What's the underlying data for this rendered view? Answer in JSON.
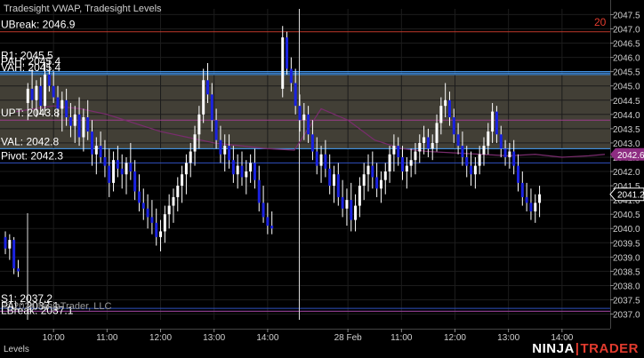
{
  "chart_data": {
    "type": "candlestick",
    "indicators_title": "Tradesight VWAP, Tradesight Levels",
    "y_range": [
      2036.8,
      2047.7
    ],
    "y_ticks": [
      "2047.5",
      "2047.0",
      "2046.5",
      "2046.0",
      "2045.5",
      "2045.0",
      "2044.5",
      "2044.0",
      "2043.5",
      "2043.0",
      "2042.5",
      "2042.0",
      "2041.5",
      "2041.0",
      "2040.5",
      "2040.0",
      "2039.5",
      "2039.0",
      "2038.5",
      "2038.0",
      "2037.5",
      "2037.0"
    ],
    "x_ticks": [
      "10:00",
      "11:00",
      "12:00",
      "13:00",
      "14:00",
      "28 Feb",
      "11:00",
      "12:00",
      "13:00",
      "14:00"
    ],
    "x_tick_positions": [
      1.0,
      2.0,
      3.0,
      4.0,
      5.0,
      6.5,
      7.5,
      8.5,
      9.5,
      10.5
    ],
    "x_range": [
      0.0,
      11.4
    ],
    "session_start_marker": 5.6,
    "levels": [
      {
        "label": "UBreak: 2046.9",
        "price": 2046.9,
        "color": "#c0392b"
      },
      {
        "label": "R1: 2045.5",
        "price": 2045.5,
        "color": "#4aa3ff"
      },
      {
        "label": "PAH: 2045.4",
        "price": 2045.45,
        "color": "#4aa3ff"
      },
      {
        "label": "VAH: 2045.4",
        "price": 2045.4,
        "color": "#4aa3ff"
      },
      {
        "label": "UPT: 2043.8",
        "price": 2043.8,
        "color": "#9b3d8a"
      },
      {
        "label": "VAL: 2042.8",
        "price": 2042.8,
        "color": "#4aa3ff"
      },
      {
        "label": "Pivot: 2042.3",
        "price": 2042.3,
        "color": "#2f4fbf"
      },
      {
        "label": "S1: 2037.2",
        "price": 2037.2,
        "color": "#2f4fbf"
      },
      {
        "label": "PAL: 2037.1",
        "price": 2037.1,
        "color": "#2f4fbf"
      },
      {
        "label": "LBreak: 2037.1",
        "price": 2037.1,
        "color": "#9b3d8a"
      }
    ],
    "value_area": {
      "top": 2045.4,
      "bottom": 2042.8,
      "color": "#4d4a3f"
    },
    "price_marker_top_text": "20",
    "price_marker_top_value": 2047.3,
    "vwap_label": "2042.6",
    "vwap_value": 2042.6,
    "last_price_label": "2041.2",
    "last_price_value": 2041.2,
    "vwap": {
      "x": [
        0.3,
        1.0,
        1.5,
        2.0,
        2.5,
        3.0,
        3.5,
        4.0,
        4.5,
        5.0,
        5.5,
        6.0,
        6.5,
        7.0,
        7.5,
        8.0,
        8.5,
        9.0,
        9.5,
        10.0,
        10.5,
        11.0,
        11.3
      ],
      "y": [
        2044.1,
        2044.3,
        2044.2,
        2044.0,
        2043.7,
        2043.4,
        2043.2,
        2043.0,
        2042.9,
        2042.8,
        2042.75,
        2044.2,
        2043.8,
        2043.1,
        2042.8,
        2042.7,
        2042.65,
        2042.6,
        2042.55,
        2042.6,
        2042.5,
        2042.55,
        2042.6
      ]
    },
    "candles": [
      {
        "x": 0.1,
        "o": 2039.7,
        "h": 2039.9,
        "l": 2039.1,
        "c": 2039.3
      },
      {
        "x": 0.18,
        "o": 2039.3,
        "h": 2039.8,
        "l": 2038.9,
        "c": 2039.6
      },
      {
        "x": 0.26,
        "o": 2039.6,
        "h": 2039.7,
        "l": 2038.4,
        "c": 2038.6
      },
      {
        "x": 0.34,
        "o": 2038.6,
        "h": 2038.9,
        "l": 2038.3,
        "c": 2038.5
      },
      {
        "x": 0.52,
        "o": 2044.4,
        "h": 2045.1,
        "l": 2043.8,
        "c": 2044.9
      },
      {
        "x": 0.6,
        "o": 2044.9,
        "h": 2045.6,
        "l": 2044.2,
        "c": 2044.5
      },
      {
        "x": 0.68,
        "o": 2044.5,
        "h": 2045.2,
        "l": 2043.9,
        "c": 2045.0
      },
      {
        "x": 0.76,
        "o": 2045.0,
        "h": 2045.3,
        "l": 2044.0,
        "c": 2044.3
      },
      {
        "x": 0.84,
        "o": 2044.3,
        "h": 2045.8,
        "l": 2044.0,
        "c": 2045.4
      },
      {
        "x": 0.92,
        "o": 2045.4,
        "h": 2045.9,
        "l": 2044.8,
        "c": 2045.0
      },
      {
        "x": 1.0,
        "o": 2045.0,
        "h": 2045.5,
        "l": 2044.4,
        "c": 2044.6
      },
      {
        "x": 1.08,
        "o": 2044.6,
        "h": 2045.0,
        "l": 2043.9,
        "c": 2044.2
      },
      {
        "x": 1.16,
        "o": 2044.2,
        "h": 2044.8,
        "l": 2043.4,
        "c": 2044.5
      },
      {
        "x": 1.24,
        "o": 2044.5,
        "h": 2044.9,
        "l": 2043.6,
        "c": 2043.9
      },
      {
        "x": 1.32,
        "o": 2043.9,
        "h": 2044.4,
        "l": 2043.2,
        "c": 2043.6
      },
      {
        "x": 1.4,
        "o": 2043.6,
        "h": 2044.3,
        "l": 2043.0,
        "c": 2044.0
      },
      {
        "x": 1.48,
        "o": 2044.0,
        "h": 2044.6,
        "l": 2042.9,
        "c": 2043.2
      },
      {
        "x": 1.56,
        "o": 2043.2,
        "h": 2044.2,
        "l": 2042.7,
        "c": 2043.9
      },
      {
        "x": 1.64,
        "o": 2043.9,
        "h": 2044.5,
        "l": 2043.1,
        "c": 2043.4
      },
      {
        "x": 1.72,
        "o": 2043.4,
        "h": 2043.8,
        "l": 2042.2,
        "c": 2042.6
      },
      {
        "x": 1.8,
        "o": 2042.6,
        "h": 2043.2,
        "l": 2041.9,
        "c": 2042.9
      },
      {
        "x": 1.88,
        "o": 2042.9,
        "h": 2043.4,
        "l": 2042.3,
        "c": 2042.5
      },
      {
        "x": 1.96,
        "o": 2042.5,
        "h": 2043.1,
        "l": 2041.8,
        "c": 2042.2
      },
      {
        "x": 2.04,
        "o": 2042.2,
        "h": 2042.8,
        "l": 2041.1,
        "c": 2041.6
      },
      {
        "x": 2.12,
        "o": 2041.6,
        "h": 2042.7,
        "l": 2041.3,
        "c": 2042.4
      },
      {
        "x": 2.2,
        "o": 2042.4,
        "h": 2042.9,
        "l": 2041.8,
        "c": 2042.1
      },
      {
        "x": 2.28,
        "o": 2042.1,
        "h": 2042.6,
        "l": 2041.4,
        "c": 2041.9
      },
      {
        "x": 2.36,
        "o": 2041.9,
        "h": 2042.5,
        "l": 2041.2,
        "c": 2042.3
      },
      {
        "x": 2.44,
        "o": 2042.3,
        "h": 2043.0,
        "l": 2041.7,
        "c": 2042.0
      },
      {
        "x": 2.52,
        "o": 2042.0,
        "h": 2042.4,
        "l": 2041.0,
        "c": 2041.3
      },
      {
        "x": 2.6,
        "o": 2041.3,
        "h": 2041.9,
        "l": 2040.6,
        "c": 2040.9
      },
      {
        "x": 2.68,
        "o": 2040.9,
        "h": 2041.4,
        "l": 2040.3,
        "c": 2040.7
      },
      {
        "x": 2.76,
        "o": 2040.7,
        "h": 2041.2,
        "l": 2040.0,
        "c": 2040.4
      },
      {
        "x": 2.84,
        "o": 2040.4,
        "h": 2041.0,
        "l": 2039.8,
        "c": 2040.2
      },
      {
        "x": 2.92,
        "o": 2040.2,
        "h": 2040.7,
        "l": 2039.4,
        "c": 2039.7
      },
      {
        "x": 3.0,
        "o": 2039.7,
        "h": 2040.3,
        "l": 2039.2,
        "c": 2039.9
      },
      {
        "x": 3.08,
        "o": 2039.9,
        "h": 2040.8,
        "l": 2039.5,
        "c": 2040.5
      },
      {
        "x": 3.16,
        "o": 2040.5,
        "h": 2041.2,
        "l": 2040.0,
        "c": 2040.8
      },
      {
        "x": 3.24,
        "o": 2040.8,
        "h": 2041.4,
        "l": 2040.2,
        "c": 2041.1
      },
      {
        "x": 3.32,
        "o": 2041.1,
        "h": 2041.8,
        "l": 2040.6,
        "c": 2041.5
      },
      {
        "x": 3.4,
        "o": 2041.5,
        "h": 2042.2,
        "l": 2040.9,
        "c": 2041.9
      },
      {
        "x": 3.48,
        "o": 2041.9,
        "h": 2042.6,
        "l": 2041.2,
        "c": 2042.3
      },
      {
        "x": 3.56,
        "o": 2042.3,
        "h": 2043.0,
        "l": 2041.8,
        "c": 2042.7
      },
      {
        "x": 3.64,
        "o": 2042.7,
        "h": 2043.6,
        "l": 2042.2,
        "c": 2043.3
      },
      {
        "x": 3.72,
        "o": 2043.3,
        "h": 2044.3,
        "l": 2042.8,
        "c": 2044.0
      },
      {
        "x": 3.8,
        "o": 2044.0,
        "h": 2045.6,
        "l": 2043.7,
        "c": 2045.2
      },
      {
        "x": 3.88,
        "o": 2045.2,
        "h": 2045.8,
        "l": 2044.4,
        "c": 2044.7
      },
      {
        "x": 3.96,
        "o": 2044.7,
        "h": 2045.1,
        "l": 2043.4,
        "c": 2043.8
      },
      {
        "x": 4.04,
        "o": 2043.8,
        "h": 2044.2,
        "l": 2042.8,
        "c": 2043.1
      },
      {
        "x": 4.12,
        "o": 2043.1,
        "h": 2043.6,
        "l": 2042.3,
        "c": 2042.6
      },
      {
        "x": 4.2,
        "o": 2042.6,
        "h": 2043.3,
        "l": 2042.0,
        "c": 2042.9
      },
      {
        "x": 4.28,
        "o": 2042.9,
        "h": 2043.3,
        "l": 2042.1,
        "c": 2042.4
      },
      {
        "x": 4.36,
        "o": 2042.4,
        "h": 2042.9,
        "l": 2041.6,
        "c": 2041.9
      },
      {
        "x": 4.44,
        "o": 2041.9,
        "h": 2042.6,
        "l": 2041.4,
        "c": 2042.2
      },
      {
        "x": 4.52,
        "o": 2042.2,
        "h": 2042.7,
        "l": 2041.5,
        "c": 2041.8
      },
      {
        "x": 4.6,
        "o": 2041.8,
        "h": 2042.4,
        "l": 2041.2,
        "c": 2042.0
      },
      {
        "x": 4.68,
        "o": 2042.0,
        "h": 2042.6,
        "l": 2041.6,
        "c": 2042.3
      },
      {
        "x": 4.76,
        "o": 2042.3,
        "h": 2042.8,
        "l": 2041.4,
        "c": 2041.7
      },
      {
        "x": 4.84,
        "o": 2041.7,
        "h": 2042.2,
        "l": 2040.6,
        "c": 2040.9
      },
      {
        "x": 4.92,
        "o": 2040.9,
        "h": 2041.5,
        "l": 2040.2,
        "c": 2040.4
      },
      {
        "x": 5.0,
        "o": 2040.4,
        "h": 2040.9,
        "l": 2039.8,
        "c": 2040.1
      },
      {
        "x": 5.08,
        "o": 2040.1,
        "h": 2040.6,
        "l": 2039.8,
        "c": 2040.0
      },
      {
        "x": 5.28,
        "o": 2044.9,
        "h": 2047.1,
        "l": 2044.6,
        "c": 2046.7
      },
      {
        "x": 5.36,
        "o": 2046.7,
        "h": 2046.9,
        "l": 2045.4,
        "c": 2045.6
      },
      {
        "x": 5.44,
        "o": 2045.6,
        "h": 2046.0,
        "l": 2044.8,
        "c": 2045.1
      },
      {
        "x": 5.52,
        "o": 2045.1,
        "h": 2045.6,
        "l": 2044.0,
        "c": 2044.3
      },
      {
        "x": 5.6,
        "o": 2044.3,
        "h": 2044.7,
        "l": 2043.4,
        "c": 2043.8
      },
      {
        "x": 5.68,
        "o": 2043.8,
        "h": 2044.4,
        "l": 2043.1,
        "c": 2044.0
      },
      {
        "x": 5.76,
        "o": 2044.0,
        "h": 2044.3,
        "l": 2043.0,
        "c": 2043.3
      },
      {
        "x": 5.84,
        "o": 2043.3,
        "h": 2043.8,
        "l": 2042.4,
        "c": 2042.7
      },
      {
        "x": 5.92,
        "o": 2042.7,
        "h": 2043.2,
        "l": 2041.9,
        "c": 2042.2
      },
      {
        "x": 6.0,
        "o": 2042.2,
        "h": 2042.9,
        "l": 2041.6,
        "c": 2042.6
      },
      {
        "x": 6.08,
        "o": 2042.6,
        "h": 2043.1,
        "l": 2041.8,
        "c": 2042.1
      },
      {
        "x": 6.16,
        "o": 2042.1,
        "h": 2042.6,
        "l": 2041.2,
        "c": 2041.5
      },
      {
        "x": 6.24,
        "o": 2041.5,
        "h": 2042.2,
        "l": 2040.9,
        "c": 2041.9
      },
      {
        "x": 6.32,
        "o": 2041.9,
        "h": 2042.3,
        "l": 2040.8,
        "c": 2041.1
      },
      {
        "x": 6.4,
        "o": 2041.1,
        "h": 2041.7,
        "l": 2040.4,
        "c": 2040.7
      },
      {
        "x": 6.48,
        "o": 2040.7,
        "h": 2041.4,
        "l": 2040.1,
        "c": 2041.0
      },
      {
        "x": 6.56,
        "o": 2041.0,
        "h": 2041.6,
        "l": 2039.9,
        "c": 2040.3
      },
      {
        "x": 6.64,
        "o": 2040.3,
        "h": 2041.2,
        "l": 2039.9,
        "c": 2040.8
      },
      {
        "x": 6.72,
        "o": 2040.8,
        "h": 2041.8,
        "l": 2040.4,
        "c": 2041.5
      },
      {
        "x": 6.8,
        "o": 2041.5,
        "h": 2042.3,
        "l": 2041.0,
        "c": 2041.9
      },
      {
        "x": 6.88,
        "o": 2041.9,
        "h": 2042.6,
        "l": 2041.3,
        "c": 2042.2
      },
      {
        "x": 6.96,
        "o": 2042.2,
        "h": 2042.7,
        "l": 2041.4,
        "c": 2041.8
      },
      {
        "x": 7.04,
        "o": 2041.8,
        "h": 2042.3,
        "l": 2041.1,
        "c": 2041.4
      },
      {
        "x": 7.12,
        "o": 2041.4,
        "h": 2042.0,
        "l": 2040.9,
        "c": 2041.7
      },
      {
        "x": 7.2,
        "o": 2041.7,
        "h": 2042.3,
        "l": 2041.2,
        "c": 2042.0
      },
      {
        "x": 7.28,
        "o": 2042.0,
        "h": 2042.9,
        "l": 2041.6,
        "c": 2042.6
      },
      {
        "x": 7.36,
        "o": 2042.6,
        "h": 2043.3,
        "l": 2042.0,
        "c": 2042.9
      },
      {
        "x": 7.44,
        "o": 2042.9,
        "h": 2043.2,
        "l": 2042.2,
        "c": 2042.5
      },
      {
        "x": 7.52,
        "o": 2042.5,
        "h": 2042.9,
        "l": 2041.7,
        "c": 2042.0
      },
      {
        "x": 7.6,
        "o": 2042.0,
        "h": 2042.5,
        "l": 2041.4,
        "c": 2042.2
      },
      {
        "x": 7.68,
        "o": 2042.2,
        "h": 2042.8,
        "l": 2041.8,
        "c": 2042.4
      },
      {
        "x": 7.76,
        "o": 2042.4,
        "h": 2043.0,
        "l": 2041.9,
        "c": 2042.7
      },
      {
        "x": 7.84,
        "o": 2042.7,
        "h": 2043.3,
        "l": 2042.3,
        "c": 2043.0
      },
      {
        "x": 7.92,
        "o": 2043.0,
        "h": 2043.6,
        "l": 2042.6,
        "c": 2043.2
      },
      {
        "x": 8.0,
        "o": 2043.2,
        "h": 2043.5,
        "l": 2042.5,
        "c": 2042.8
      },
      {
        "x": 8.08,
        "o": 2042.8,
        "h": 2043.3,
        "l": 2042.4,
        "c": 2043.0
      },
      {
        "x": 8.16,
        "o": 2043.0,
        "h": 2044.0,
        "l": 2042.7,
        "c": 2043.7
      },
      {
        "x": 8.24,
        "o": 2043.7,
        "h": 2044.6,
        "l": 2043.3,
        "c": 2044.3
      },
      {
        "x": 8.32,
        "o": 2044.3,
        "h": 2045.1,
        "l": 2043.9,
        "c": 2044.5
      },
      {
        "x": 8.4,
        "o": 2044.5,
        "h": 2044.8,
        "l": 2043.6,
        "c": 2043.9
      },
      {
        "x": 8.48,
        "o": 2043.9,
        "h": 2044.2,
        "l": 2043.0,
        "c": 2043.3
      },
      {
        "x": 8.56,
        "o": 2043.3,
        "h": 2043.7,
        "l": 2042.6,
        "c": 2042.9
      },
      {
        "x": 8.64,
        "o": 2042.9,
        "h": 2043.4,
        "l": 2042.2,
        "c": 2042.5
      },
      {
        "x": 8.72,
        "o": 2042.5,
        "h": 2042.9,
        "l": 2041.8,
        "c": 2042.2
      },
      {
        "x": 8.8,
        "o": 2042.2,
        "h": 2042.7,
        "l": 2041.5,
        "c": 2041.9
      },
      {
        "x": 8.88,
        "o": 2041.9,
        "h": 2042.5,
        "l": 2041.4,
        "c": 2042.2
      },
      {
        "x": 8.96,
        "o": 2042.2,
        "h": 2042.9,
        "l": 2041.9,
        "c": 2042.6
      },
      {
        "x": 9.04,
        "o": 2042.6,
        "h": 2043.2,
        "l": 2042.2,
        "c": 2042.9
      },
      {
        "x": 9.12,
        "o": 2042.9,
        "h": 2043.7,
        "l": 2042.6,
        "c": 2043.4
      },
      {
        "x": 9.2,
        "o": 2043.4,
        "h": 2044.4,
        "l": 2043.0,
        "c": 2044.1
      },
      {
        "x": 9.28,
        "o": 2044.1,
        "h": 2044.3,
        "l": 2043.0,
        "c": 2043.3
      },
      {
        "x": 9.36,
        "o": 2043.3,
        "h": 2043.6,
        "l": 2042.5,
        "c": 2042.8
      },
      {
        "x": 9.44,
        "o": 2042.8,
        "h": 2043.1,
        "l": 2042.2,
        "c": 2042.5
      },
      {
        "x": 9.52,
        "o": 2042.5,
        "h": 2043.0,
        "l": 2042.1,
        "c": 2042.7
      },
      {
        "x": 9.6,
        "o": 2042.7,
        "h": 2043.1,
        "l": 2041.9,
        "c": 2042.2
      },
      {
        "x": 9.68,
        "o": 2042.2,
        "h": 2042.6,
        "l": 2041.3,
        "c": 2041.6
      },
      {
        "x": 9.76,
        "o": 2041.6,
        "h": 2042.0,
        "l": 2040.8,
        "c": 2041.1
      },
      {
        "x": 9.84,
        "o": 2041.1,
        "h": 2041.6,
        "l": 2040.6,
        "c": 2040.9
      },
      {
        "x": 9.92,
        "o": 2040.9,
        "h": 2041.4,
        "l": 2040.3,
        "c": 2040.6
      },
      {
        "x": 10.0,
        "o": 2040.6,
        "h": 2041.2,
        "l": 2040.2,
        "c": 2040.9
      },
      {
        "x": 10.08,
        "o": 2040.9,
        "h": 2041.5,
        "l": 2040.4,
        "c": 2041.2
      }
    ]
  },
  "header": {
    "title": "Tradesight VWAP, Tradesight Levels"
  },
  "footer": {
    "copyright": "© 2024 NinjaTrader, LLC",
    "tab_name": "Levels",
    "brand_ninja": "NINJA",
    "brand_trader": "TRADER"
  },
  "colors": {
    "background": "#000000",
    "bull_candle_wick": "#ffffff",
    "bear_candle_body": "#1a22e0",
    "vwap_line": "#7a2c6e",
    "vwap_badge": "#8e2d82"
  }
}
